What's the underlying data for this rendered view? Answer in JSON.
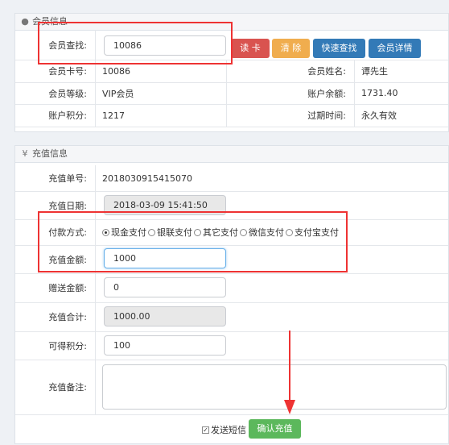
{
  "member_panel": {
    "title": "会员信息",
    "search_label": "会员查找:",
    "search_value": "10086",
    "buttons": {
      "read_card": "读 卡",
      "clear": "清 除",
      "quick_search": "快速查找",
      "details": "会员详情"
    },
    "fields": {
      "card_no_label": "会员卡号:",
      "card_no": "10086",
      "name_label": "会员姓名:",
      "name": "谭先生",
      "level_label": "会员等级:",
      "level": "VIP会员",
      "balance_label": "账户余额:",
      "balance": "1731.40",
      "points_label": "账户积分:",
      "points": "1217",
      "expire_label": "过期时间:",
      "expire": "永久有效"
    }
  },
  "recharge_panel": {
    "title": "充值信息",
    "order_label": "充值单号:",
    "order_no": "2018030915415070",
    "date_label": "充值日期:",
    "date": "2018-03-09 15:41:50",
    "pay_label": "付款方式:",
    "pay_options": [
      "现金支付",
      "银联支付",
      "其它支付",
      "微信支付",
      "支付宝支付"
    ],
    "amount_label": "充值金额:",
    "amount": "1000",
    "bonus_label": "赠送金额:",
    "bonus": "0",
    "total_label": "充值合计:",
    "total": "1000.00",
    "earn_label": "可得积分:",
    "earn": "100",
    "remark_label": "充值备注:",
    "sms_label": "发送短信",
    "confirm_button": "确认充值"
  },
  "colors": {
    "read_card": "#d9534f",
    "clear": "#f0ad4e",
    "quick_search": "#337ab7",
    "details": "#337ab7",
    "confirm": "#5cb85c",
    "highlight": "#e33333"
  }
}
